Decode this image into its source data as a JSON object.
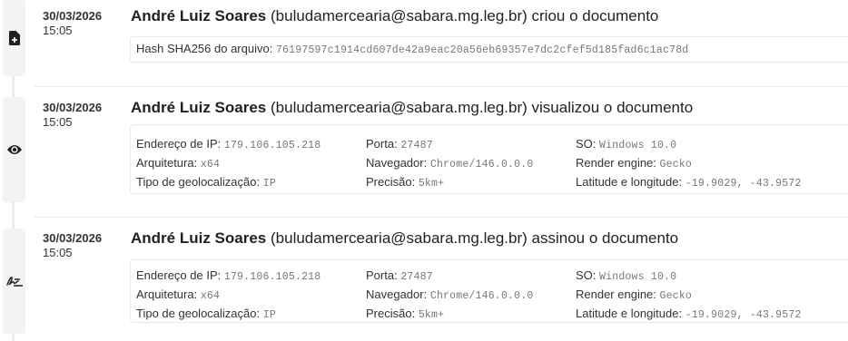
{
  "events": [
    {
      "icon": "document-add-icon",
      "date": "30/03/2026",
      "time": "15:05",
      "name": "André Luiz Soares",
      "email_text": "(buludamercearia@sabara.mg.leg.br)",
      "action": "criou o documento",
      "hash_label": "Hash SHA256 do arquivo:",
      "hash_value": "76197597c1914cd607de42a9eac20a56eb69357e7dc2cfef5d185fad6c1ac78d"
    },
    {
      "icon": "eye-icon",
      "date": "30/03/2026",
      "time": "15:05",
      "name": "André Luiz Soares",
      "email_text": "(buludamercearia@sabara.mg.leg.br)",
      "action": "visualizou o documento",
      "details": {
        "ip_label": "Endereço de IP:",
        "ip": "179.106.105.218",
        "port_label": "Porta:",
        "port": "27487",
        "os_label": "SO:",
        "os": "Windows 10.0",
        "arch_label": "Arquitetura:",
        "arch": "x64",
        "browser_label": "Navegador:",
        "browser": "Chrome/146.0.0.0",
        "engine_label": "Render engine:",
        "engine": "Gecko",
        "geo_label": "Tipo de geolocalização:",
        "geo": "IP",
        "precision_label": "Precisão:",
        "precision": "5km+",
        "latlng_label": "Latitude e longitude:",
        "latlng": "-19.9029, -43.9572"
      }
    },
    {
      "icon": "signature-icon",
      "date": "30/03/2026",
      "time": "15:05",
      "name": "André Luiz Soares",
      "email_text": "(buludamercearia@sabara.mg.leg.br)",
      "action": "assinou o documento",
      "details": {
        "ip_label": "Endereço de IP:",
        "ip": "179.106.105.218",
        "port_label": "Porta:",
        "port": "27487",
        "os_label": "SO:",
        "os": "Windows 10.0",
        "arch_label": "Arquitetura:",
        "arch": "x64",
        "browser_label": "Navegador:",
        "browser": "Chrome/146.0.0.0",
        "engine_label": "Render engine:",
        "engine": "Gecko",
        "geo_label": "Tipo de geolocalização:",
        "geo": "IP",
        "precision_label": "Precisão:",
        "precision": "5km+",
        "latlng_label": "Latitude e longitude:",
        "latlng": "-19.9029, -43.9572"
      }
    }
  ]
}
